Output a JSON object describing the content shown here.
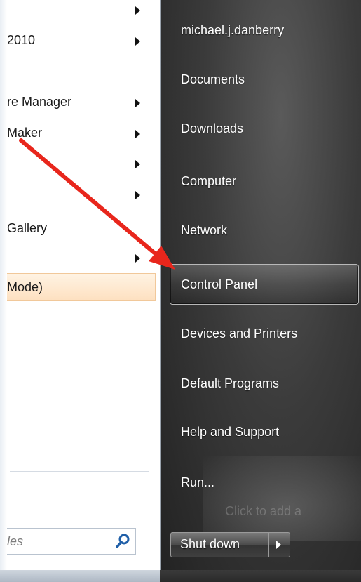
{
  "programs": [
    {
      "id": "p1",
      "label": "",
      "has_submenu": true
    },
    {
      "id": "p2",
      "label": "2010",
      "has_submenu": true
    },
    {
      "id": "p3",
      "label": "re Manager",
      "has_submenu": true
    },
    {
      "id": "p4",
      "label": "Maker",
      "has_submenu": true
    },
    {
      "id": "p5",
      "label": "",
      "has_submenu": true
    },
    {
      "id": "p6",
      "label": "",
      "has_submenu": true
    },
    {
      "id": "p7",
      "label": "Gallery",
      "has_submenu": false
    },
    {
      "id": "p8",
      "label": "",
      "has_submenu": true
    }
  ],
  "highlighted_program": {
    "label": "Mode)"
  },
  "search": {
    "placeholder": "les",
    "icon": "magnifier-icon"
  },
  "right_links": {
    "user": "michael.j.danberry",
    "documents": "Documents",
    "downloads": "Downloads",
    "computer": "Computer",
    "network": "Network",
    "control_panel": "Control Panel",
    "devices": "Devices and Printers",
    "default_programs": "Default Programs",
    "help": "Help and Support",
    "run": "Run..."
  },
  "ghost_text": "Click to add a",
  "shutdown": {
    "label": "Shut down",
    "arrow_icon": "chevron-right-icon"
  },
  "annotation": {
    "color": "#e8261c",
    "icon": "red-arrow-annotation"
  }
}
